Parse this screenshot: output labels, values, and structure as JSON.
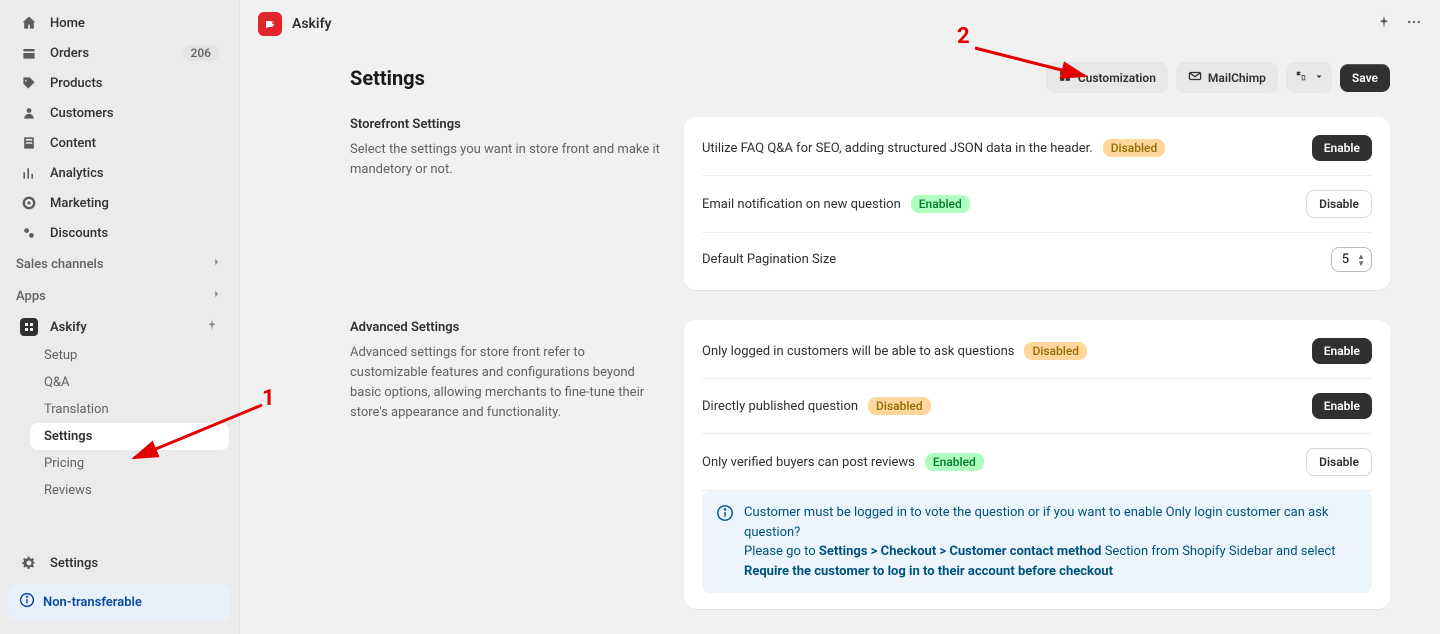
{
  "sidebar": {
    "nav": [
      {
        "label": "Home"
      },
      {
        "label": "Orders",
        "badge": "206"
      },
      {
        "label": "Products"
      },
      {
        "label": "Customers"
      },
      {
        "label": "Content"
      },
      {
        "label": "Analytics"
      },
      {
        "label": "Marketing"
      },
      {
        "label": "Discounts"
      }
    ],
    "salesChannels": "Sales channels",
    "apps": "Apps",
    "appName": "Askify",
    "sub": [
      {
        "label": "Setup"
      },
      {
        "label": "Q&A"
      },
      {
        "label": "Translation"
      },
      {
        "label": "Settings",
        "active": true
      },
      {
        "label": "Pricing"
      },
      {
        "label": "Reviews"
      }
    ],
    "settings": "Settings",
    "nonTransferable": "Non-transferable"
  },
  "topbar": {
    "appName": "Askify"
  },
  "header": {
    "title": "Settings",
    "customization": "Customization",
    "mailchimp": "MailChimp",
    "save": "Save"
  },
  "storefront": {
    "title": "Storefront Settings",
    "desc": "Select the settings you want in store front and make it mandetory or not.",
    "rows": [
      {
        "text": "Utilize FAQ Q&A for SEO, adding structured JSON data in the header.",
        "status": "Disabled",
        "statusType": "disabled",
        "action": "Enable",
        "actionType": "enable"
      },
      {
        "text": "Email notification on new question",
        "status": "Enabled",
        "statusType": "enabled",
        "action": "Disable",
        "actionType": "disable"
      }
    ],
    "paginationLabel": "Default Pagination Size",
    "paginationValue": "5"
  },
  "advanced": {
    "title": "Advanced Settings",
    "desc": "Advanced settings for store front refer to customizable features and configurations beyond basic options, allowing merchants to fine-tune their store's appearance and functionality.",
    "rows": [
      {
        "text": "Only logged in customers will be able to ask questions",
        "status": "Disabled",
        "statusType": "disabled",
        "action": "Enable",
        "actionType": "enable"
      },
      {
        "text": "Directly published question",
        "status": "Disabled",
        "statusType": "disabled",
        "action": "Enable",
        "actionType": "enable"
      },
      {
        "text": "Only verified buyers can post reviews",
        "status": "Enabled",
        "statusType": "enabled",
        "action": "Disable",
        "actionType": "disable"
      }
    ],
    "info": {
      "line1": "Customer must be logged in to vote the question or if you want to enable Only login customer can ask question?",
      "line2a": "Please go to ",
      "line2b": "Settings > Checkout > Customer contact method",
      "line2c": " Section from Shopify Sidebar and select ",
      "line2d": "Require the customer to log in to their account before checkout"
    }
  },
  "annotations": {
    "n1": "1",
    "n2": "2"
  }
}
